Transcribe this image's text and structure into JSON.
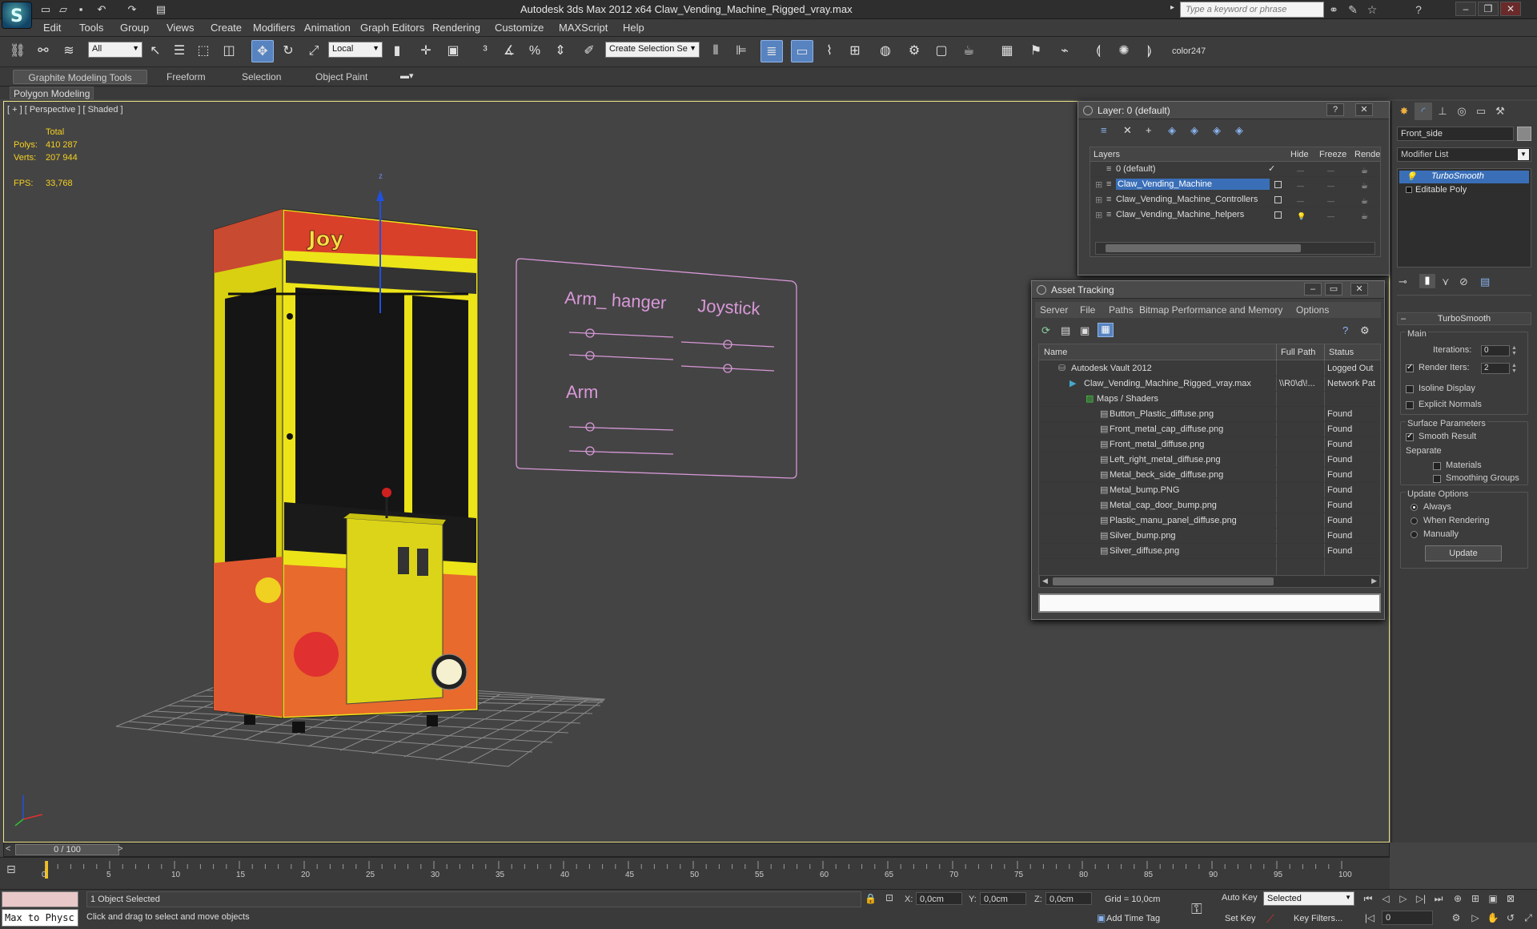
{
  "window": {
    "title": "Autodesk 3ds Max  2012 x64       Claw_Vending_Machine_Rigged_vray.max",
    "search_placeholder": "Type a keyword or phrase",
    "controls": [
      "minimize-icon",
      "restore-icon",
      "close-icon"
    ]
  },
  "menu": [
    "Edit",
    "Tools",
    "Group",
    "Views",
    "Create",
    "Modifiers",
    "Animation",
    "Graph Editors",
    "Rendering",
    "Customize",
    "MAXScript",
    "Help"
  ],
  "toolbar": {
    "selection_filter": "All",
    "coord_system": "Local",
    "named_selection": "Create Selection Se",
    "color_label": "color247"
  },
  "ribbon": {
    "tabs": [
      "Graphite Modeling Tools",
      "Freeform",
      "Selection",
      "Object Paint"
    ],
    "sub_tab": "Polygon Modeling"
  },
  "viewport": {
    "label": "[ + ] [ Perspective ] [ Shaded ]",
    "stats": {
      "total_label": "Total",
      "polys_label": "Polys:",
      "polys": "410 287",
      "verts_label": "Verts:",
      "verts": "207 944",
      "fps_label": "FPS:",
      "fps": "33,768"
    },
    "axis_z": "z",
    "rig_panel": {
      "arm_hanger": "Arm_ hanger",
      "joystick": "Joystick",
      "arm": "Arm"
    }
  },
  "layer_dialog": {
    "title": "Layer: 0 (default)",
    "columns": [
      "Layers",
      "Hide",
      "Freeze",
      "Rende"
    ],
    "layers": [
      {
        "name": "0 (default)"
      },
      {
        "name": "Claw_Vending_Machine"
      },
      {
        "name": "Claw_Vending_Machine_Controllers"
      },
      {
        "name": "Claw_Vending_Machine_helpers"
      }
    ]
  },
  "asset_tracking": {
    "title": "Asset Tracking",
    "menu": [
      "Server",
      "File",
      "Paths",
      "Bitmap Performance and Memory",
      "Options"
    ],
    "columns": [
      "Name",
      "Full Path",
      "Status"
    ],
    "rows": [
      {
        "name": "Autodesk Vault 2012",
        "path": "",
        "status": "Logged Out"
      },
      {
        "name": "Claw_Vending_Machine_Rigged_vray.max",
        "path": "\\\\R0\\d\\!...",
        "status": "Network Pat"
      },
      {
        "name": "Maps / Shaders",
        "path": "",
        "status": ""
      },
      {
        "name": "Button_Plastic_diffuse.png",
        "path": "",
        "status": "Found"
      },
      {
        "name": "Front_metal_cap_diffuse.png",
        "path": "",
        "status": "Found"
      },
      {
        "name": "Front_metal_diffuse.png",
        "path": "",
        "status": "Found"
      },
      {
        "name": "Left_right_metal_diffuse.png",
        "path": "",
        "status": "Found"
      },
      {
        "name": "Metal_beck_side_diffuse.png",
        "path": "",
        "status": "Found"
      },
      {
        "name": "Metal_bump.PNG",
        "path": "",
        "status": "Found"
      },
      {
        "name": "Metal_cap_door_bump.png",
        "path": "",
        "status": "Found"
      },
      {
        "name": "Plastic_manu_panel_diffuse.png",
        "path": "",
        "status": "Found"
      },
      {
        "name": "Silver_bump.png",
        "path": "",
        "status": "Found"
      },
      {
        "name": "Silver_diffuse.png",
        "path": "",
        "status": "Found"
      }
    ]
  },
  "command_panel": {
    "object_name": "Front_side",
    "modifier_list": "Modifier List",
    "stack": [
      "TurboSmooth",
      "Editable Poly"
    ],
    "turbosmooth": {
      "title": "TurboSmooth",
      "main": "Main",
      "iterations_label": "Iterations:",
      "iterations": "0",
      "render_iters_label": "Render Iters:",
      "render_iters": "2",
      "isoline": "Isoline Display",
      "explicit": "Explicit Normals",
      "surface": "Surface Parameters",
      "smooth_result": "Smooth Result",
      "separate": "Separate",
      "materials": "Materials",
      "smoothing_groups": "Smoothing Groups",
      "update_options": "Update Options",
      "always": "Always",
      "when_rendering": "When Rendering",
      "manually": "Manually",
      "update_btn": "Update"
    }
  },
  "timeline": {
    "frame": "0 / 100",
    "ticks": [
      "0",
      "5",
      "10",
      "15",
      "20",
      "25",
      "30",
      "35",
      "40",
      "45",
      "50",
      "55",
      "60",
      "65",
      "70",
      "75",
      "80",
      "85",
      "90",
      "95",
      "100"
    ]
  },
  "status": {
    "maxscript": "Max to Physc",
    "selected": "1 Object Selected",
    "prompt": "Click and drag to select and move objects",
    "x_label": "X:",
    "x": "0,0cm",
    "y_label": "Y:",
    "y": "0,0cm",
    "z_label": "Z:",
    "z": "0,0cm",
    "grid": "Grid = 10,0cm",
    "auto_key": "Auto Key",
    "set_key": "Set Key",
    "selected_dd": "Selected",
    "key_filters": "Key Filters...",
    "add_time_tag": "Add Time Tag",
    "frame_field": "0"
  },
  "colors": {
    "machine_yellow": "#e8e010",
    "accent_blue": "#3a6fb8",
    "viewport_border": "#f0e68c",
    "rig_pink": "#d898d8"
  }
}
